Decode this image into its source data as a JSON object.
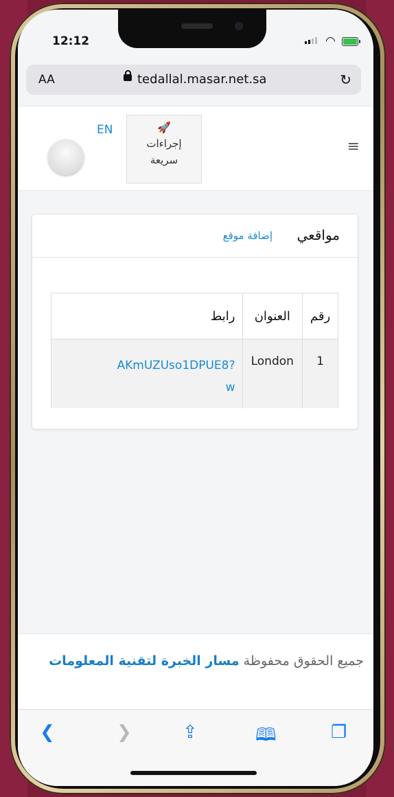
{
  "status_bar": {
    "time": "12:12"
  },
  "browser": {
    "text_size_label": "AA",
    "url": "tedallal.masar.net.sa"
  },
  "header": {
    "language_toggle": "EN",
    "quick_actions_line1": "إجراءات",
    "quick_actions_line2": "سريعة"
  },
  "card": {
    "title": "مواقعي",
    "add_link": "إضافة موقع",
    "table": {
      "columns": [
        "رقم",
        "العنوان",
        "رابط"
      ],
      "rows": [
        {
          "number": "1",
          "address": "London",
          "link_line1": "AKmUZUso1DPUE8?",
          "link_line2": "w"
        }
      ]
    }
  },
  "footer": {
    "text_prefix": "جميع الحقوق محفوظة",
    "brand": "مسار الخبرة لتقنية المعلومات"
  },
  "colors": {
    "link": "#1a8ad6",
    "accent": "#1a7cf0",
    "background": "#7d1c38"
  }
}
